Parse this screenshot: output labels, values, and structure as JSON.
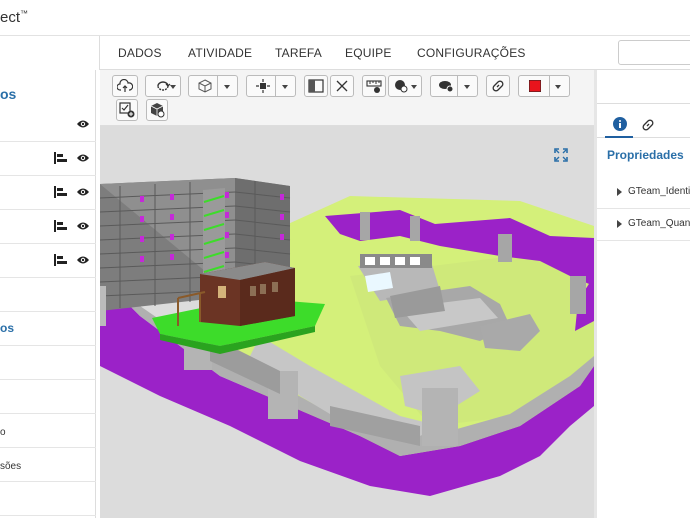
{
  "app": {
    "brand": "ect",
    "brand_mark": "™"
  },
  "nav": {
    "items": [
      "DADOS",
      "ATIVIDADE",
      "TAREFA",
      "EQUIPE",
      "CONFIGURAÇÕES"
    ],
    "search_placeholder": ""
  },
  "sidebar": {
    "title": "os",
    "section_title": "os",
    "rows": [
      {
        "label": "",
        "icons": [
          "eye-icon"
        ]
      },
      {
        "label": "",
        "icons": [
          "bar-chart-icon",
          "eye-icon"
        ]
      },
      {
        "label": "",
        "icons": [
          "bar-chart-icon",
          "eye-icon"
        ]
      },
      {
        "label": "",
        "icons": [
          "bar-chart-icon",
          "eye-icon"
        ]
      },
      {
        "label": "",
        "icons": [
          "bar-chart-icon",
          "eye-icon"
        ]
      }
    ],
    "lower_items": [
      "o",
      "sões"
    ]
  },
  "toolbar": {
    "buttons": [
      "cloud-upload-icon",
      "rotate-view-icon",
      "cube-icon",
      "crosshair-icon",
      "split-view-icon",
      "close-icon",
      "measure-icon",
      "markup-icon",
      "comment-icon",
      "link-icon",
      "color-swatch-icon",
      "add-issue-icon",
      "package-icon"
    ],
    "swatch_color": "#e8141c"
  },
  "viewport": {
    "expand_icon": "expand-icon",
    "scene": "3d-bim-model"
  },
  "properties": {
    "tabs": [
      "info-icon",
      "link-icon"
    ],
    "title": "Propriedades",
    "groups": [
      "GTeam_Identit",
      "GTeam_Quant"
    ]
  },
  "colors": {
    "accent": "#2a6fa8",
    "purple_road": "#9b22c8",
    "lawn": "#d4f07a",
    "grass": "#3ddc2a"
  }
}
